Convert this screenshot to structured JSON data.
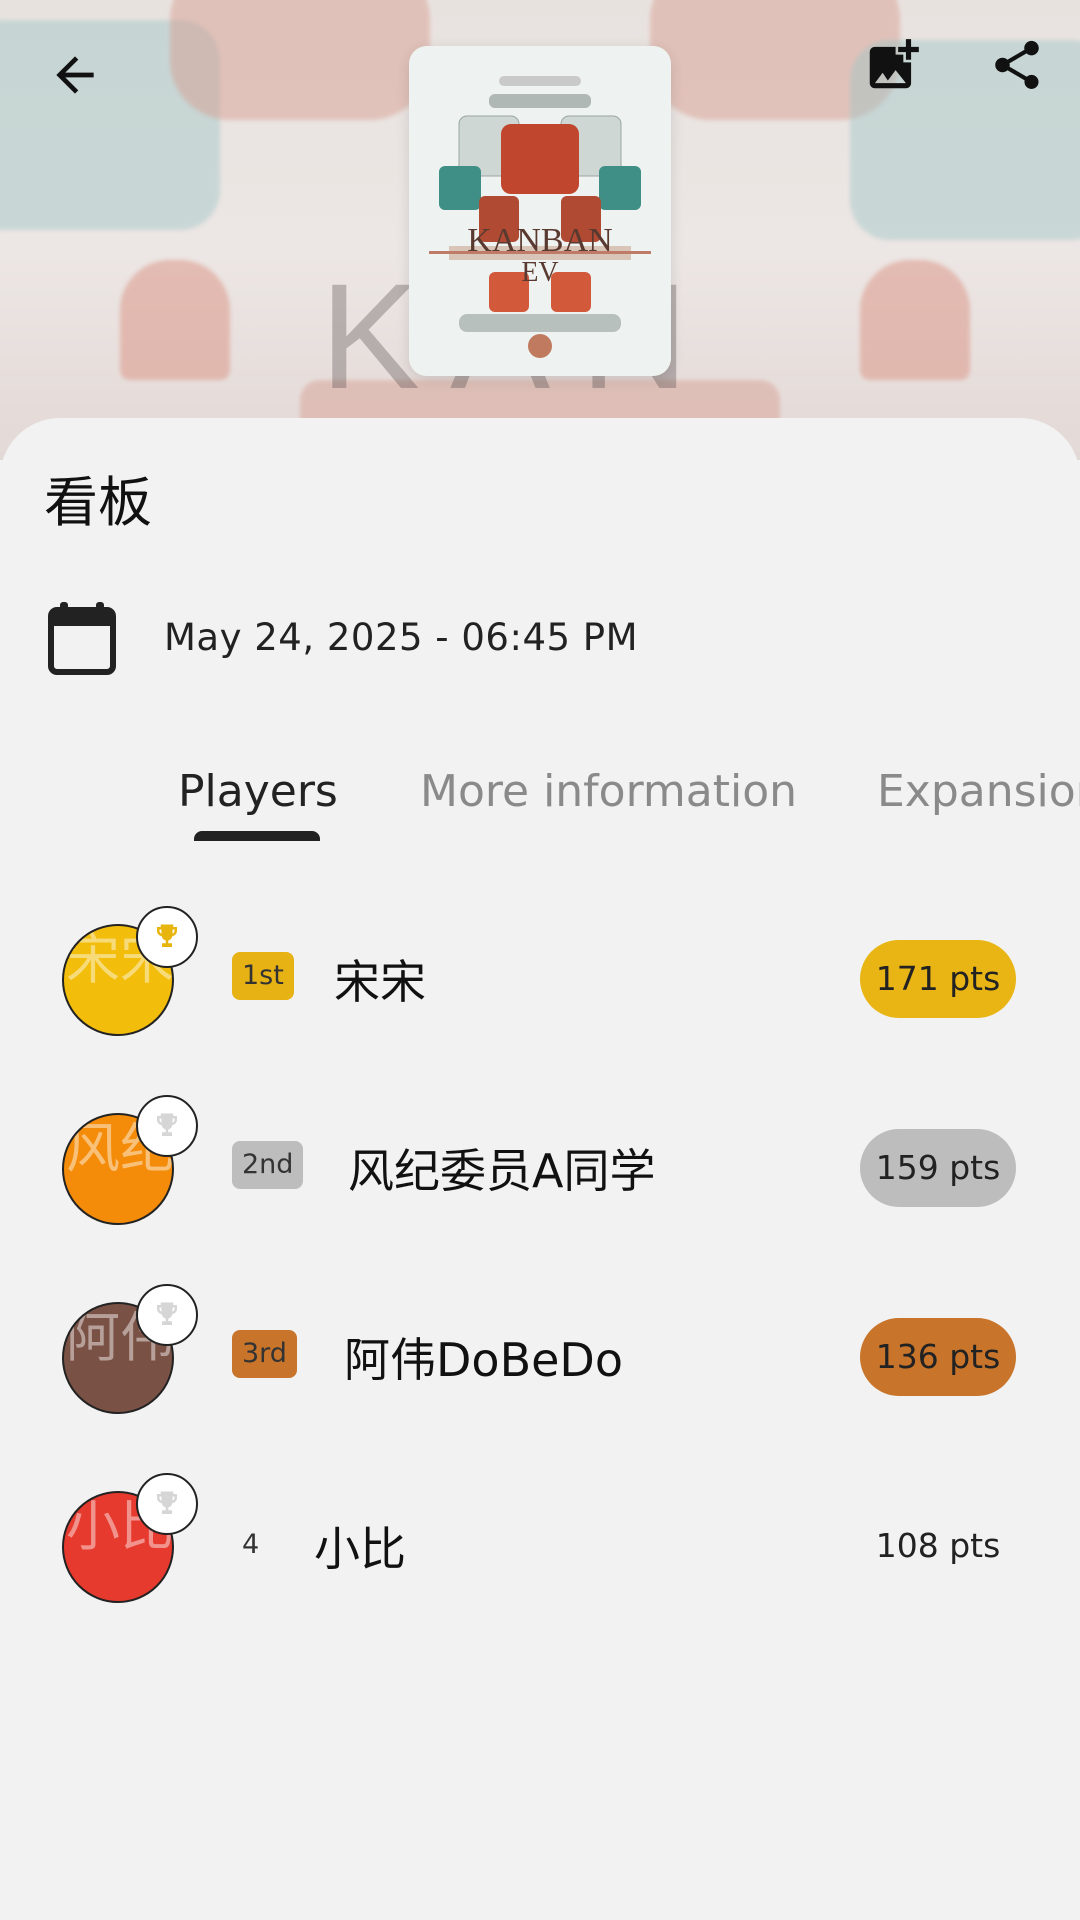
{
  "header": {
    "back_icon": "arrow-back-icon",
    "add_image_icon": "add-photo-icon",
    "share_icon": "share-icon",
    "cover_icon": "kanban-ev-box-art"
  },
  "game": {
    "title": "看板",
    "date": "May 24, 2025 - 06:45 PM"
  },
  "tabs": [
    {
      "label": "Players",
      "active": true
    },
    {
      "label": "More information",
      "active": false
    },
    {
      "label": "Expansions",
      "active": false
    }
  ],
  "players": [
    {
      "rank": "1st",
      "name": "宋宋",
      "score": "171 pts",
      "avatar_text": "宋宋",
      "avatar_color": "#f2bd0b",
      "rank_color": "#e6b214",
      "score_color": "#e9b514",
      "trophy_color": "#e8b40e"
    },
    {
      "rank": "2nd",
      "name": "风纪委员A同学",
      "score": "159 pts",
      "avatar_text": "风纪",
      "avatar_color": "#f48c0a",
      "rank_color": "#bdbdbd",
      "score_color": "#bdbdbd",
      "trophy_color": "#d6d6d6"
    },
    {
      "rank": "3rd",
      "name": "阿伟DoBeDo",
      "score": "136 pts",
      "avatar_text": "阿伟",
      "avatar_color": "#7a5245",
      "rank_color": "#c8742b",
      "score_color": "#c8742b",
      "trophy_color": "#d6d6d6"
    },
    {
      "rank": "4",
      "name": "小比",
      "score": "108 pts",
      "avatar_text": "小比",
      "avatar_color": "#e63a2e",
      "rank_color": "",
      "score_color": "",
      "trophy_color": "#d6d6d6"
    }
  ]
}
